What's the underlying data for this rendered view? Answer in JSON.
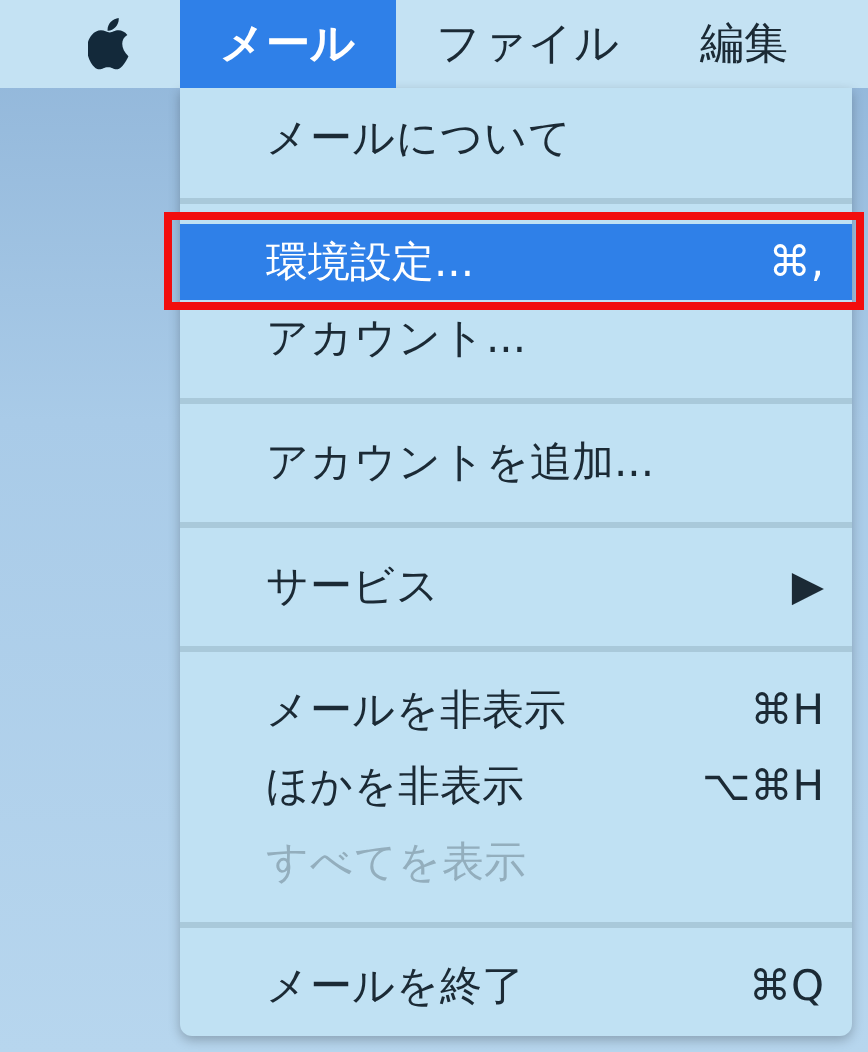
{
  "menu_bar": {
    "items": [
      {
        "label": "メール",
        "selected": true
      },
      {
        "label": "ファイル",
        "selected": false
      },
      {
        "label": "編集",
        "selected": false
      }
    ]
  },
  "menu": {
    "items": [
      {
        "kind": "item",
        "label": "メールについて",
        "selected": false,
        "disabled": false
      },
      {
        "kind": "separator"
      },
      {
        "kind": "item",
        "label": "環境設定...",
        "shortcut": "⌘,",
        "selected": true,
        "disabled": false,
        "outlined": true
      },
      {
        "kind": "item",
        "label": "アカウント...",
        "selected": false,
        "disabled": false
      },
      {
        "kind": "separator"
      },
      {
        "kind": "item",
        "label": "アカウントを追加...",
        "selected": false,
        "disabled": false
      },
      {
        "kind": "separator"
      },
      {
        "kind": "item",
        "label": "サービス",
        "submenu": "▶",
        "selected": false,
        "disabled": false
      },
      {
        "kind": "separator"
      },
      {
        "kind": "item",
        "label": "メールを非表示",
        "shortcut": "⌘H",
        "selected": false,
        "disabled": false
      },
      {
        "kind": "item",
        "label": "ほかを非表示",
        "shortcut": "⌥⌘H",
        "selected": false,
        "disabled": false
      },
      {
        "kind": "item",
        "label": "すべてを表示",
        "selected": false,
        "disabled": true
      },
      {
        "kind": "separator"
      },
      {
        "kind": "item",
        "label": "メールを終了",
        "shortcut": "⌘Q",
        "selected": false,
        "disabled": false
      }
    ]
  }
}
